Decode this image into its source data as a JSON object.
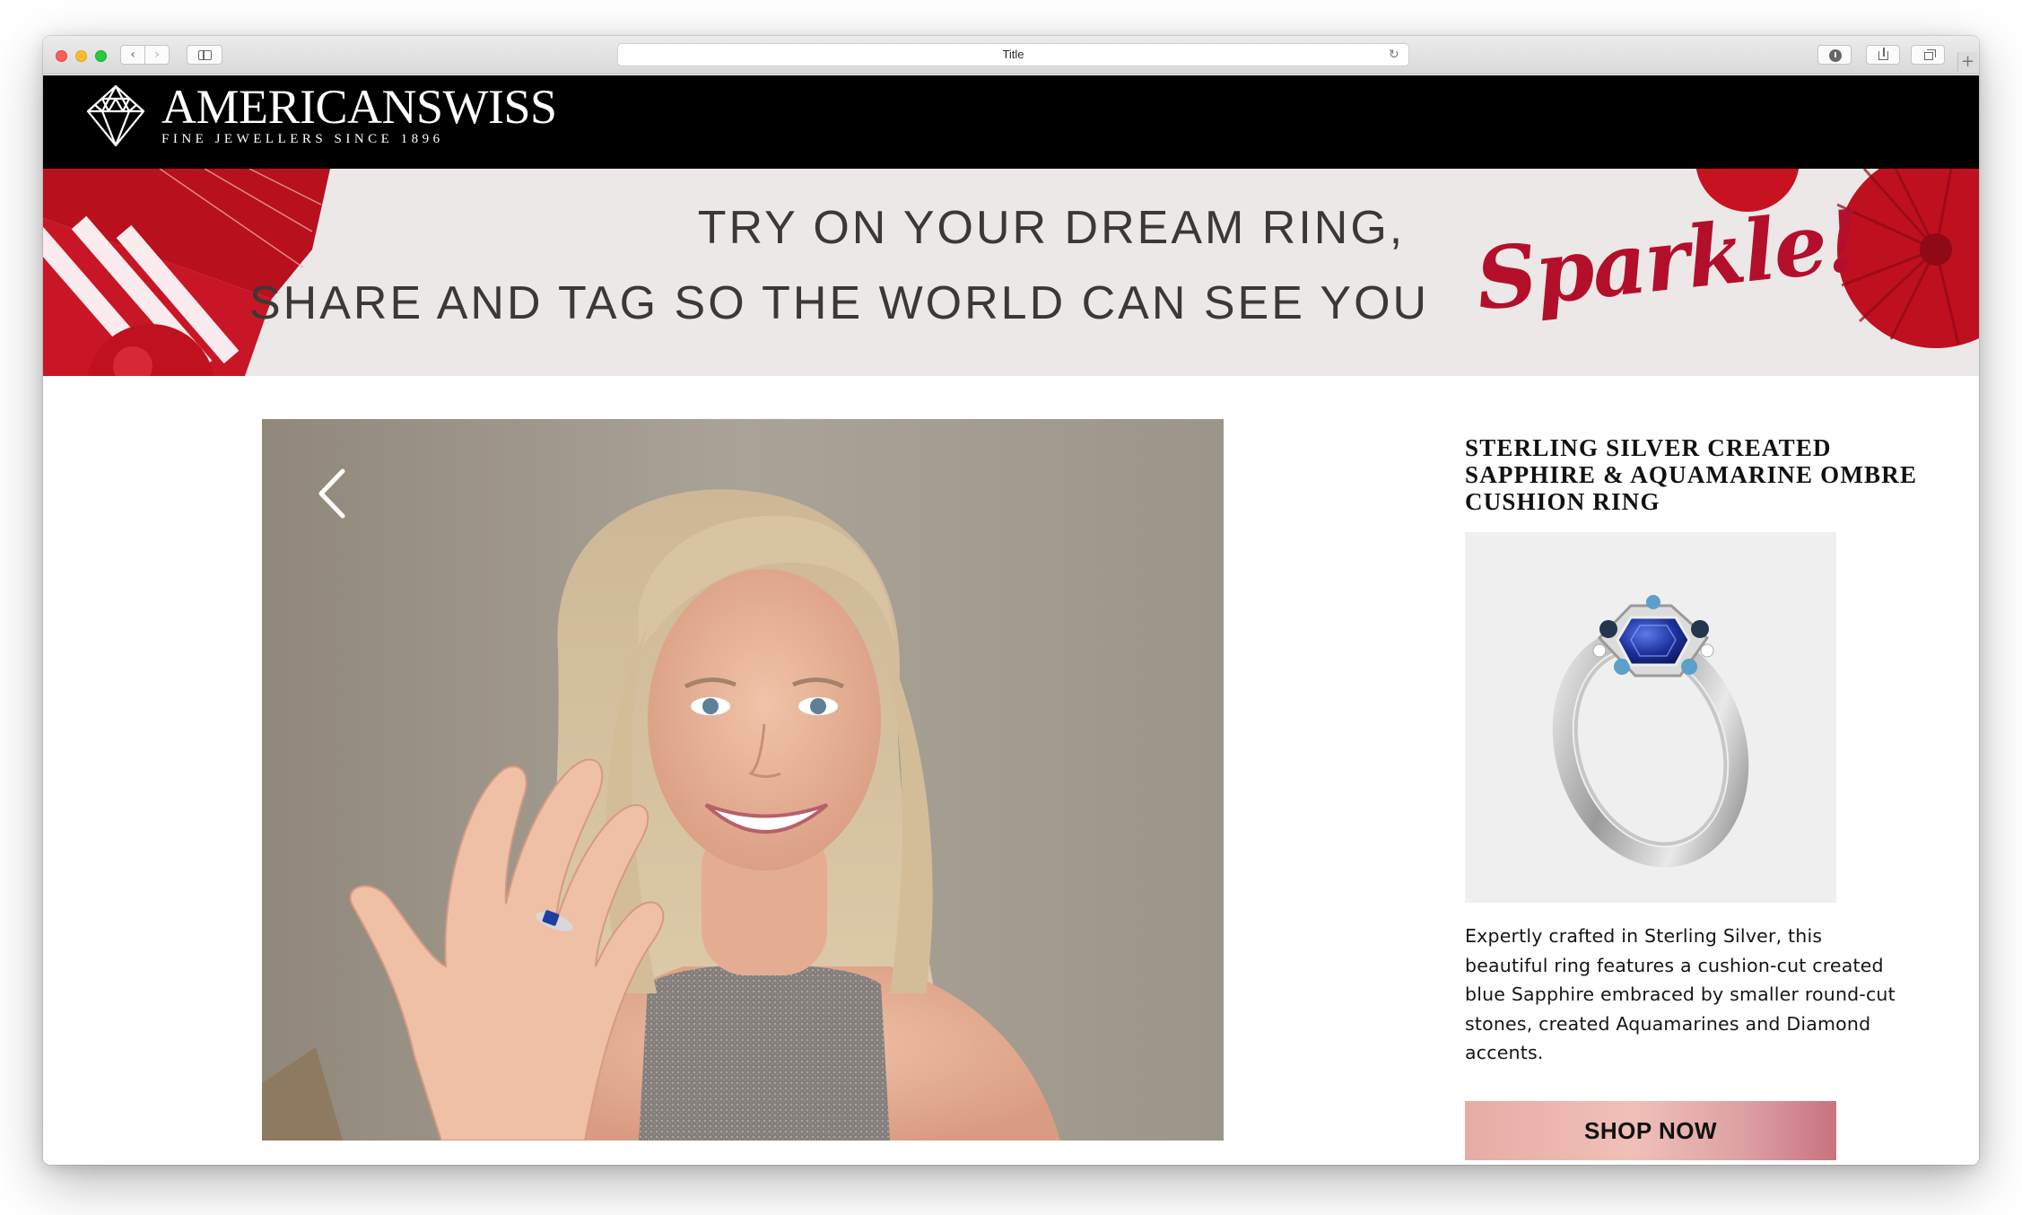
{
  "browser": {
    "tab_title": "Title",
    "controls": {
      "back": "‹",
      "forward": "›",
      "reload": "↻",
      "new_tab": "+"
    }
  },
  "brand": {
    "name": "AMERICANSWISS",
    "tagline": "FINE JEWELLERS SINCE 1896"
  },
  "banner": {
    "line1": "TRY ON YOUR DREAM RING,",
    "line2": "SHARE AND TAG SO THE WORLD CAN SEE YOU",
    "script_word": "Sparkle!"
  },
  "gallery": {
    "prev_symbol": "‹"
  },
  "product": {
    "title": "STERLING SILVER CREATED SAPPHIRE & AQUAMARINE OMBRE CUSHION RING",
    "description": "Expertly crafted in Sterling Silver, this beautiful ring features a cushion-cut created blue Sapphire embraced by smaller round-cut stones, created Aquamarines and Diamond accents.",
    "cta_label": "SHOP NOW"
  },
  "colors": {
    "header_bg": "#000000",
    "banner_bg": "#ece8e8",
    "accent_red": "#b40f2a",
    "cta_gradient_start": "#e6aca4",
    "cta_gradient_end": "#c7737e"
  }
}
